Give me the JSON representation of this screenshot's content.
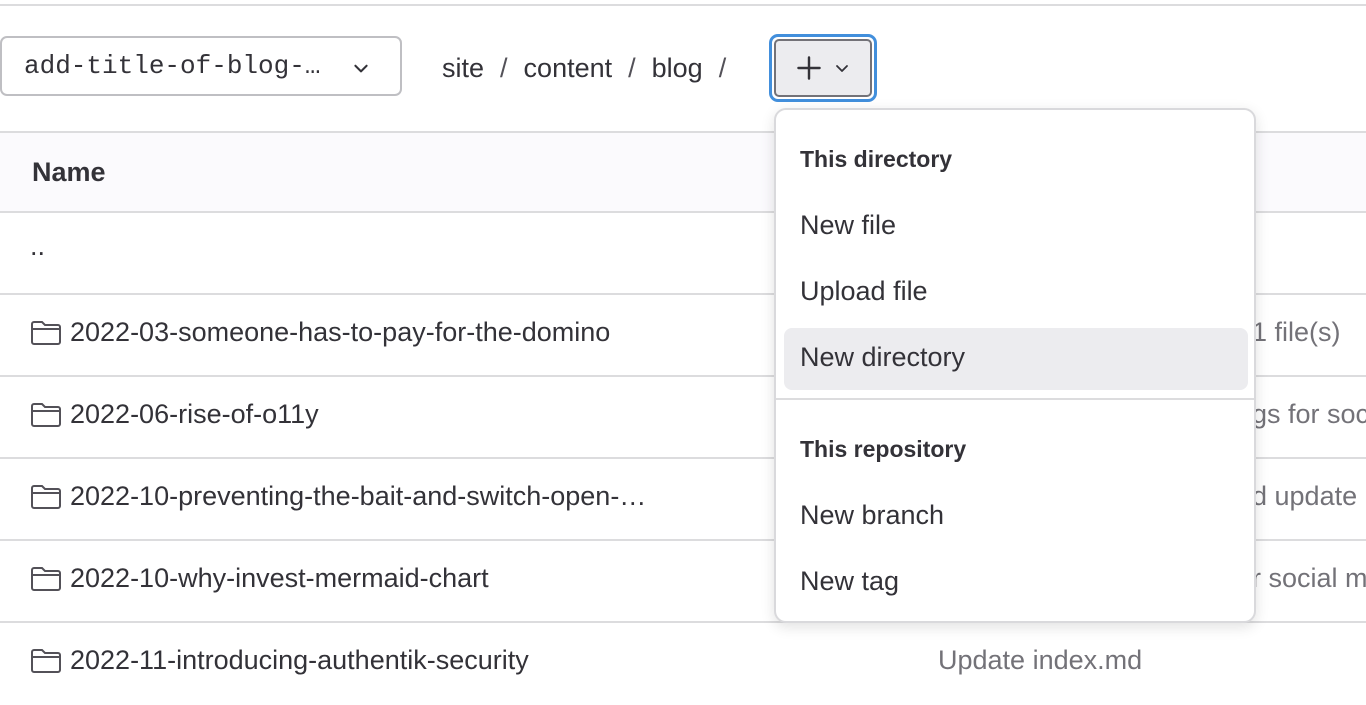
{
  "branch_selector": {
    "label": "add-title-of-blog-…"
  },
  "breadcrumb": {
    "items": [
      "site",
      "content",
      "blog"
    ],
    "separator": "/"
  },
  "table": {
    "header": {
      "name": "Name"
    },
    "parent_link": "..",
    "rows": [
      {
        "name": "2022-03-someone-has-to-pay-for-the-domino",
        "message": "1 file(s)"
      },
      {
        "name": "2022-06-rise-of-o11y",
        "message": "gs for soc"
      },
      {
        "name": "2022-10-preventing-the-bait-and-switch-open-…",
        "message": "d update"
      },
      {
        "name": "2022-10-why-invest-mermaid-chart",
        "message": "r social m"
      },
      {
        "name": "2022-11-introducing-authentik-security",
        "message": "Update index.md"
      }
    ]
  },
  "dropdown": {
    "section_directory": "This directory",
    "new_file": "New file",
    "upload_file": "Upload file",
    "new_directory": "New directory",
    "section_repository": "This repository",
    "new_branch": "New branch",
    "new_tag": "New tag"
  },
  "icons": {
    "branch_chevron": "chevron-down-icon",
    "add": "plus-icon",
    "folder": "folder-icon"
  },
  "colors": {
    "focus_ring": "#428fdc",
    "active_item": "#ececef",
    "border": "#dcdcde"
  }
}
